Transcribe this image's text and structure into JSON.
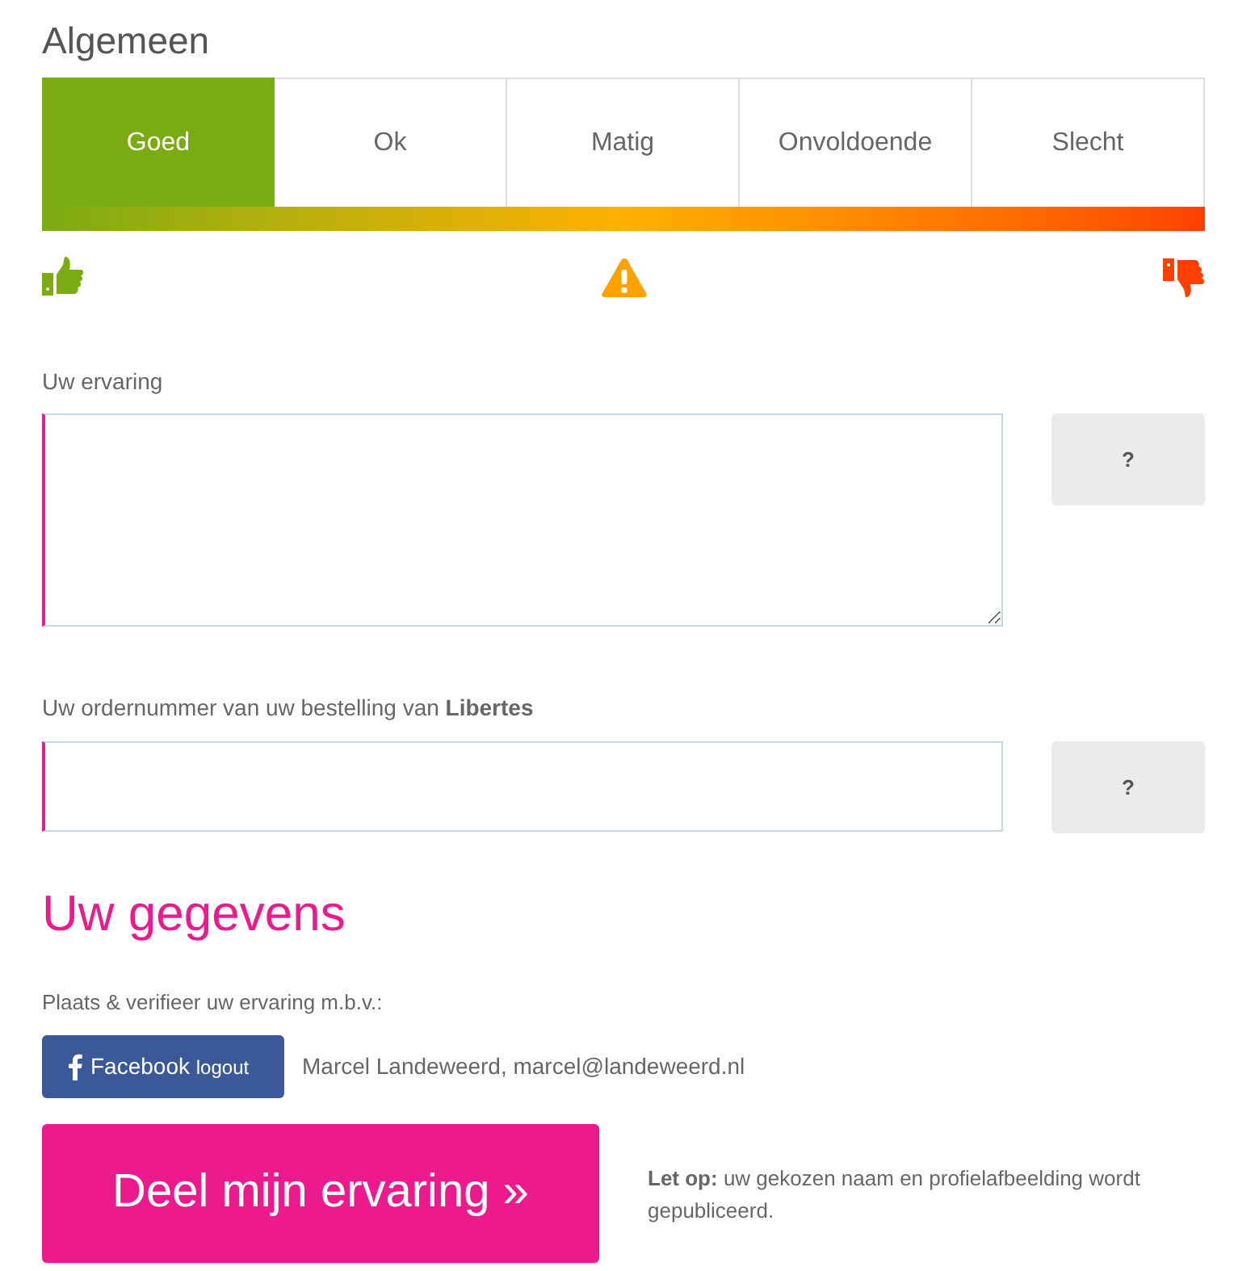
{
  "general": {
    "title": "Algemeen",
    "ratings": [
      {
        "label": "Goed",
        "selected": true
      },
      {
        "label": "Ok",
        "selected": false
      },
      {
        "label": "Matig",
        "selected": false
      },
      {
        "label": "Onvoldoende",
        "selected": false
      },
      {
        "label": "Slecht",
        "selected": false
      }
    ]
  },
  "experience": {
    "label": "Uw ervaring",
    "help_button": "?"
  },
  "order_number": {
    "label": "Uw ordernummer van uw bestelling van **Libertes**",
    "help_button": "?"
  },
  "details": {
    "title": "Uw gegevens",
    "verify_label": "Plaats & verifieer uw ervaring m.b.v.:",
    "facebook_button": {
      "label": "Facebook",
      "action": "logout"
    },
    "user": "Marcel Landeweerd, marcel@landeweerd.nl"
  },
  "submit": {
    "button": "Deel mijn ervaring »",
    "note": "**Let op:** uw gekozen naam en profielafbeelding wordt gepubliceerd."
  }
}
